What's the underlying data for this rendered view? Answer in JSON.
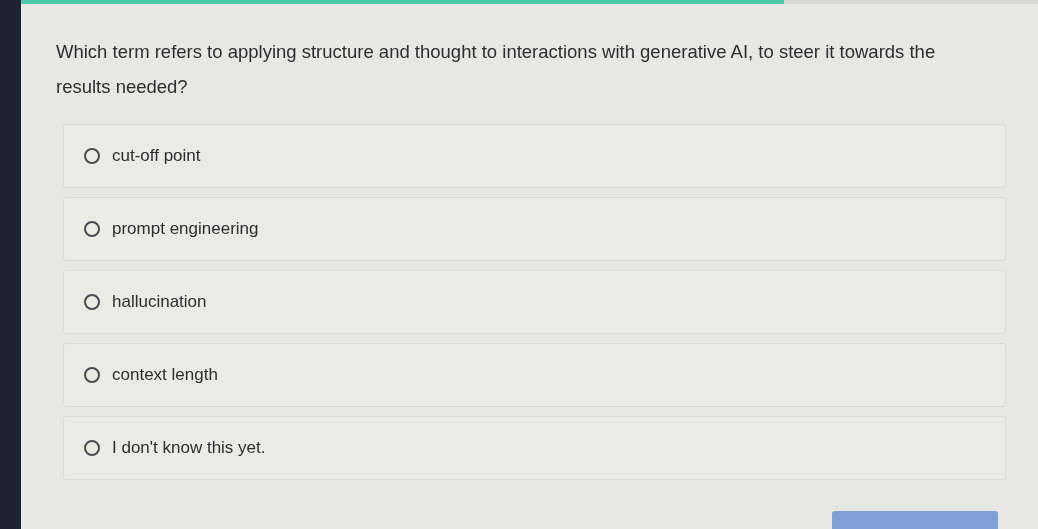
{
  "progress": {
    "level": 0.75
  },
  "question": "Which term refers to applying structure and thought to interactions with generative AI, to steer it towards the results needed?",
  "options": [
    {
      "label": "cut-off point",
      "selected": false
    },
    {
      "label": "prompt engineering",
      "selected": false
    },
    {
      "label": "hallucination",
      "selected": false
    },
    {
      "label": "context length",
      "selected": false
    },
    {
      "label": "I don't know this yet.",
      "selected": false
    }
  ]
}
